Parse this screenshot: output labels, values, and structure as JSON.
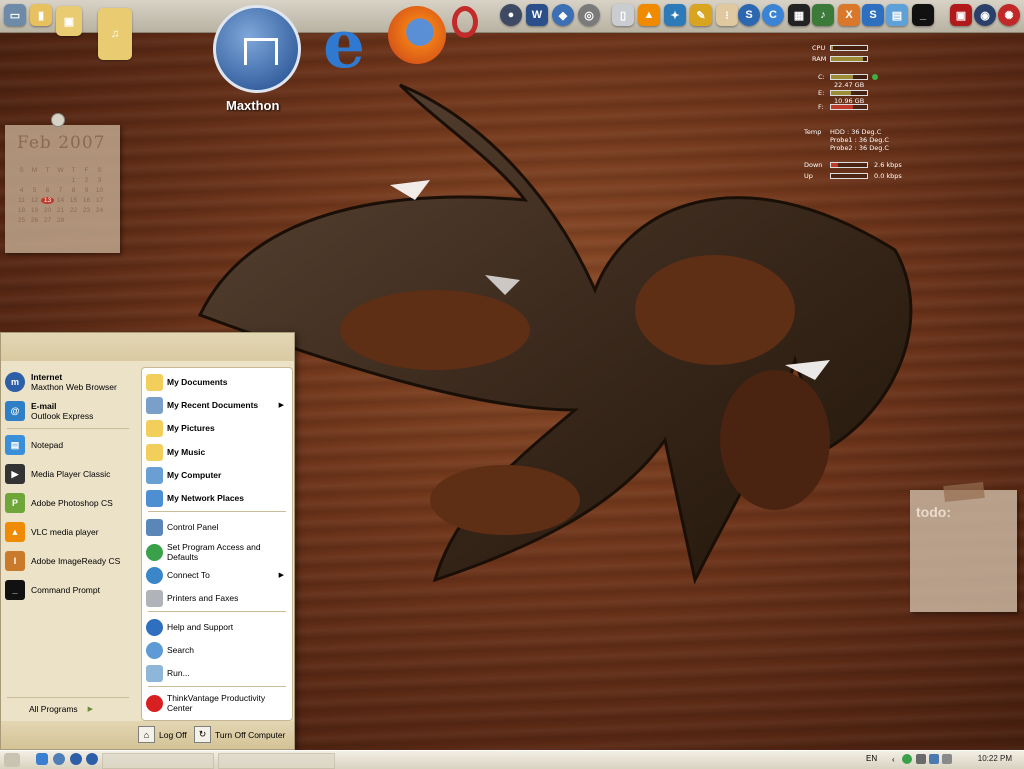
{
  "desktop": {
    "maxthon_label": "Maxthon",
    "calendar": {
      "title": "Feb 2007",
      "weekdays": [
        "S",
        "M",
        "T",
        "W",
        "T",
        "F",
        "S"
      ],
      "days": [
        "",
        "",
        "",
        "",
        "1",
        "2",
        "3",
        "4",
        "5",
        "6",
        "7",
        "8",
        "9",
        "10",
        "11",
        "12",
        "13",
        "14",
        "15",
        "16",
        "17",
        "18",
        "19",
        "20",
        "21",
        "22",
        "23",
        "24",
        "25",
        "26",
        "27",
        "28",
        "",
        "",
        ""
      ],
      "today": "13"
    },
    "todo_title": "todo:"
  },
  "sysmon": {
    "cpu_label": "CPU",
    "ram_label": "RAM",
    "c_label": "C:",
    "c_value": "22.47 GB",
    "e_label": "E:",
    "e_value": "10.96 GB",
    "f_label": "F:",
    "temp_label": "Temp",
    "temp_rows": [
      "HDD   : 36 Deg.C",
      "Probe1 : 36 Deg.C",
      "Probe2 : 36 Deg.C"
    ],
    "down_label": "Down",
    "down_value": "2.6 kbps",
    "up_label": "Up",
    "up_value": "0.0 kbps",
    "cpu_level": 0.05,
    "ram_level": 0.9,
    "c_level": 0.6,
    "e_level": 0.55,
    "f_level": 0.6
  },
  "start_menu": {
    "pinned": [
      {
        "title": "Internet",
        "subtitle": "Maxthon Web Browser",
        "icon": "maxthon-icon",
        "color": "#2d5fa8"
      },
      {
        "title": "E-mail",
        "subtitle": "Outlook Express",
        "icon": "outlook-express-icon",
        "color": "#2f7fc6"
      }
    ],
    "recent": [
      {
        "label": "Notepad",
        "icon": "notepad-icon",
        "color": "#3b8fd8"
      },
      {
        "label": "Media Player Classic",
        "icon": "media-player-classic-icon",
        "color": "#333333"
      },
      {
        "label": "Adobe Photoshop CS",
        "icon": "photoshop-icon",
        "color": "#6fa63a"
      },
      {
        "label": "VLC media player",
        "icon": "vlc-icon",
        "color": "#f08a00"
      },
      {
        "label": "Adobe ImageReady CS",
        "icon": "imageready-icon",
        "color": "#c97a2a"
      },
      {
        "label": "Command Prompt",
        "icon": "command-prompt-icon",
        "color": "#111111"
      }
    ],
    "all_programs": "All Programs",
    "right_items": [
      {
        "label": "My Documents",
        "icon": "folder-icon",
        "bold": true,
        "arrow": false
      },
      {
        "label": "My Recent Documents",
        "icon": "recent-documents-icon",
        "bold": true,
        "arrow": true
      },
      {
        "label": "My Pictures",
        "icon": "folder-icon",
        "bold": true,
        "arrow": false
      },
      {
        "label": "My Music",
        "icon": "folder-icon",
        "bold": true,
        "arrow": false
      },
      {
        "label": "My Computer",
        "icon": "computer-icon",
        "bold": true,
        "arrow": false
      },
      {
        "label": "My Network Places",
        "icon": "network-icon",
        "bold": true,
        "arrow": false
      },
      {
        "label": "Control Panel",
        "icon": "control-panel-icon",
        "bold": false,
        "arrow": false
      },
      {
        "label": "Set Program Access and Defaults",
        "icon": "program-access-icon",
        "bold": false,
        "arrow": false
      },
      {
        "label": "Connect To",
        "icon": "connect-icon",
        "bold": false,
        "arrow": true
      },
      {
        "label": "Printers and Faxes",
        "icon": "printer-icon",
        "bold": false,
        "arrow": false
      },
      {
        "label": "Help and Support",
        "icon": "help-icon",
        "bold": false,
        "arrow": false
      },
      {
        "label": "Search",
        "icon": "search-icon",
        "bold": false,
        "arrow": false
      },
      {
        "label": "Run...",
        "icon": "run-icon",
        "bold": false,
        "arrow": false
      },
      {
        "label": "ThinkVantage Productivity Center",
        "icon": "thinkvantage-icon",
        "bold": false,
        "arrow": false
      }
    ],
    "log_off": "Log Off",
    "turn_off": "Turn Off Computer"
  },
  "taskbar": {
    "language": "EN",
    "clock": "10:22 PM"
  }
}
